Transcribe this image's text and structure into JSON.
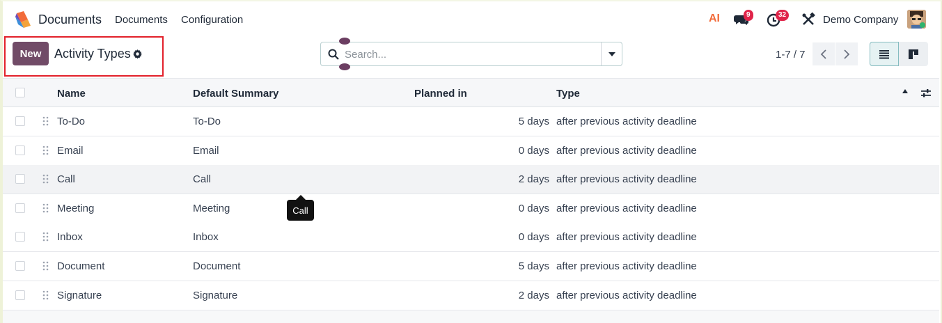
{
  "navbar": {
    "app_name": "Documents",
    "menus": [
      "Documents",
      "Configuration"
    ],
    "ai_label": "AI",
    "messages_count": "9",
    "activities_count": "32",
    "company": "Demo Company"
  },
  "control_panel": {
    "new_label": "New",
    "title": "Activity Types",
    "search_placeholder": "Search...",
    "pager": "1-7 / 7"
  },
  "table": {
    "columns": [
      "Name",
      "Default Summary",
      "Planned in",
      "Type"
    ],
    "rows": [
      {
        "name": "To-Do",
        "summary": "To-Do",
        "planned": "5 days",
        "type": "after previous activity deadline"
      },
      {
        "name": "Email",
        "summary": "Email",
        "planned": "0 days",
        "type": "after previous activity deadline"
      },
      {
        "name": "Call",
        "summary": "Call",
        "planned": "2 days",
        "type": "after previous activity deadline"
      },
      {
        "name": "Meeting",
        "summary": "Meeting",
        "planned": "0 days",
        "type": "after previous activity deadline"
      },
      {
        "name": "Inbox",
        "summary": "Inbox",
        "planned": "0 days",
        "type": "after previous activity deadline"
      },
      {
        "name": "Document",
        "summary": "Document",
        "planned": "5 days",
        "type": "after previous activity deadline"
      },
      {
        "name": "Signature",
        "summary": "Signature",
        "planned": "2 days",
        "type": "after previous activity deadline"
      }
    ]
  },
  "tooltip": "Call",
  "colors": {
    "brand": "#714b67",
    "badge": "#e0254a",
    "highlight": "#e2202a",
    "row_hover": "#f2f3f5"
  }
}
